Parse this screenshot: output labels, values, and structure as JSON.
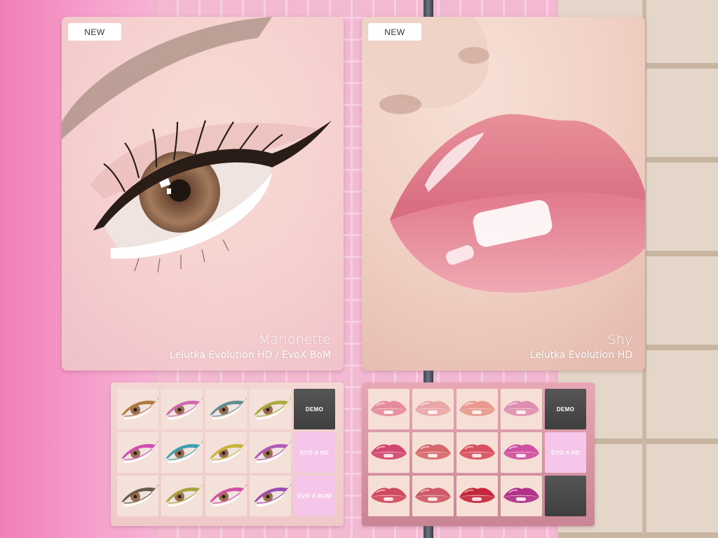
{
  "cards": [
    {
      "badge": "NEW",
      "name": "Marionette",
      "subtitle": "Lelutka Evolution HD / EvoX BoM"
    },
    {
      "badge": "NEW",
      "name": "Shy",
      "subtitle": "Lelutka Evolution HD"
    }
  ],
  "eye_palette": {
    "swatch_colors": [
      [
        "#b07a3e",
        "#d06ab0",
        "#5f8f92",
        "#a9ad3d"
      ],
      [
        "#d04db3",
        "#3f9fb3",
        "#c9b53a",
        "#b05ab8"
      ],
      [
        "#6a5a4a",
        "#a9a240",
        "#d24fa8",
        "#9a4fb0"
      ]
    ],
    "tiles": [
      "DEMO",
      "EVO X HD",
      "EVO X BOM"
    ]
  },
  "lip_palette": {
    "swatch_colors": [
      [
        "#e58b9b",
        "#e8a6a6",
        "#e79a8d",
        "#de8fb1"
      ],
      [
        "#d1476f",
        "#d5686b",
        "#d84f5f",
        "#cf4fa0"
      ],
      [
        "#cf4a5e",
        "#cf5a6a",
        "#c5283d",
        "#b0308a"
      ]
    ],
    "tiles": [
      "DEMO",
      "EVO X HD",
      ""
    ]
  }
}
